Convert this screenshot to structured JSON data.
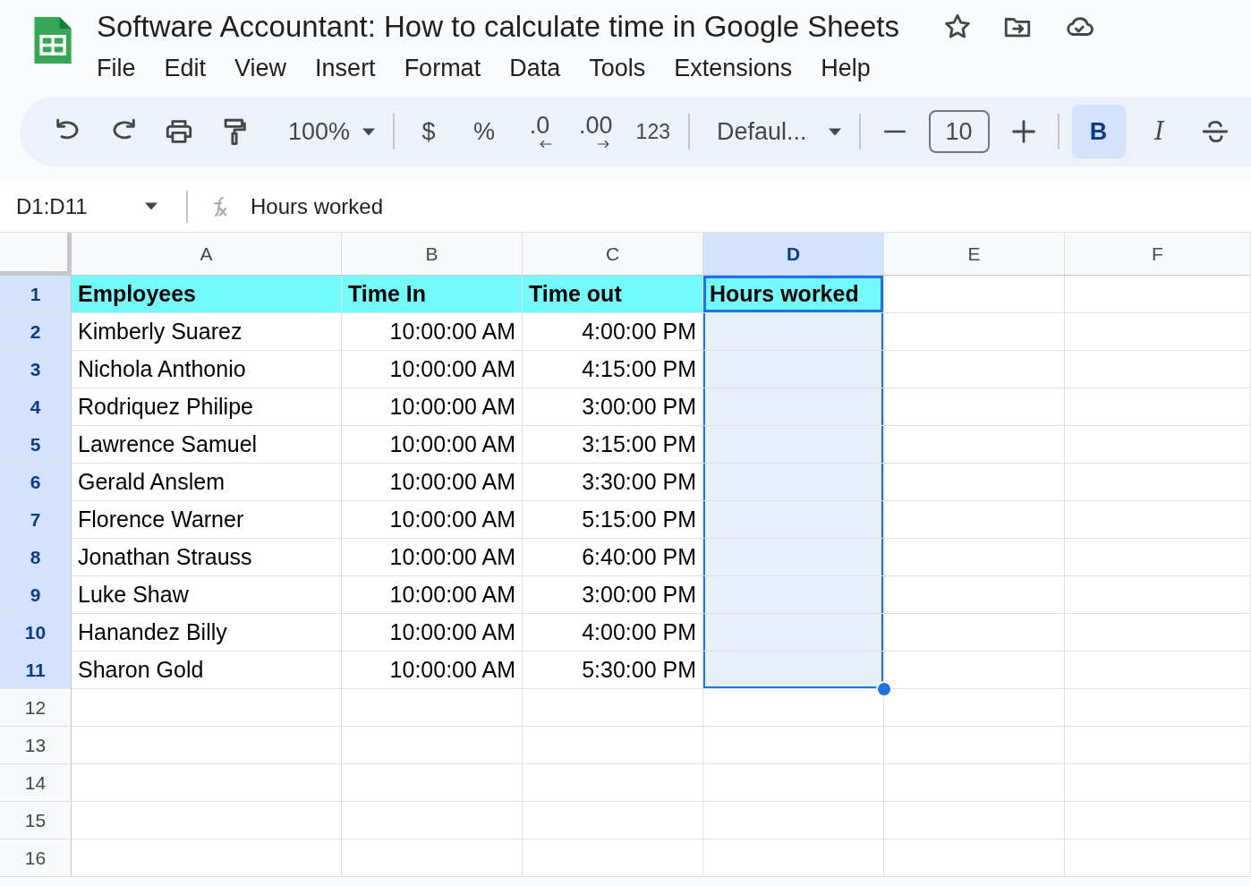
{
  "document": {
    "title": "Software Accountant: How to calculate time in Google Sheets"
  },
  "menu": [
    "File",
    "Edit",
    "View",
    "Insert",
    "Format",
    "Data",
    "Tools",
    "Extensions",
    "Help"
  ],
  "toolbar": {
    "zoom": "100%",
    "currency": "$",
    "percent": "%",
    "decrease_decimals": ".0",
    "increase_decimals": ".00",
    "number_format": "123",
    "font": "Defaul...",
    "font_size": "10",
    "bold": {
      "label": "B",
      "selected": true
    },
    "italic": {
      "label": "I",
      "selected": false
    }
  },
  "formula_bar": {
    "name_box": "D1:D11",
    "formula": "Hours worked"
  },
  "columns": [
    {
      "label": "A",
      "selected": false,
      "kind": "text"
    },
    {
      "label": "B",
      "selected": false,
      "kind": "time"
    },
    {
      "label": "C",
      "selected": false,
      "kind": "time"
    },
    {
      "label": "D",
      "selected": true,
      "kind": "text"
    },
    {
      "label": "E",
      "selected": false,
      "kind": "text"
    },
    {
      "label": "F",
      "selected": false,
      "kind": "text"
    }
  ],
  "header_row": {
    "number": "1",
    "selected": true,
    "cells": [
      "Employees",
      "Time In",
      "Time out",
      "Hours worked"
    ]
  },
  "rows": [
    {
      "number": "2",
      "selected": true,
      "cells": [
        "Kimberly Suarez",
        "10:00:00 AM",
        "4:00:00 PM"
      ]
    },
    {
      "number": "3",
      "selected": true,
      "cells": [
        "Nichola Anthonio",
        "10:00:00 AM",
        "4:15:00 PM"
      ]
    },
    {
      "number": "4",
      "selected": true,
      "cells": [
        "Rodriquez Philipe",
        "10:00:00 AM",
        "3:00:00 PM"
      ]
    },
    {
      "number": "5",
      "selected": true,
      "cells": [
        "Lawrence Samuel",
        "10:00:00 AM",
        "3:15:00 PM"
      ]
    },
    {
      "number": "6",
      "selected": true,
      "cells": [
        "Gerald Anslem",
        "10:00:00 AM",
        "3:30:00 PM"
      ]
    },
    {
      "number": "7",
      "selected": true,
      "cells": [
        "Florence Warner",
        "10:00:00 AM",
        "5:15:00 PM"
      ]
    },
    {
      "number": "8",
      "selected": true,
      "cells": [
        "Jonathan Strauss",
        "10:00:00 AM",
        "6:40:00 PM"
      ]
    },
    {
      "number": "9",
      "selected": true,
      "cells": [
        "Luke Shaw",
        "10:00:00 AM",
        "3:00:00 PM"
      ]
    },
    {
      "number": "10",
      "selected": true,
      "cells": [
        "Hanandez Billy",
        "10:00:00 AM",
        "4:00:00 PM"
      ]
    },
    {
      "number": "11",
      "selected": true,
      "cells": [
        "Sharon Gold",
        "10:00:00 AM",
        "5:30:00 PM"
      ]
    },
    {
      "number": "12",
      "selected": false,
      "cells": []
    },
    {
      "number": "13",
      "selected": false,
      "cells": []
    },
    {
      "number": "14",
      "selected": false,
      "cells": []
    },
    {
      "number": "15",
      "selected": false,
      "cells": []
    },
    {
      "number": "16",
      "selected": false,
      "cells": []
    }
  ]
}
